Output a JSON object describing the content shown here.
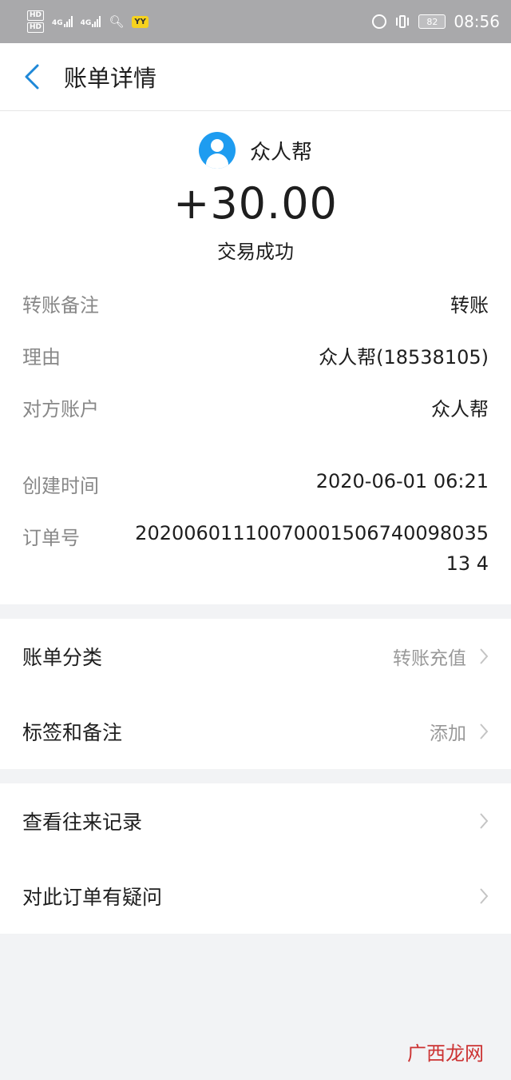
{
  "status_bar": {
    "hd1": "HD",
    "hd2": "HD",
    "net1": "4G",
    "net2": "4G",
    "yy": "YY",
    "battery": "82",
    "time": "08:56"
  },
  "nav": {
    "title": "账单详情"
  },
  "summary": {
    "payer_name": "众人帮",
    "amount": "+30.00",
    "status": "交易成功"
  },
  "details": {
    "rows": [
      {
        "label": "转账备注",
        "value": "转账"
      },
      {
        "label": "理由",
        "value": "众人帮(18538105)"
      },
      {
        "label": "对方账户",
        "value": "众人帮"
      },
      {
        "label": "创建时间",
        "value": "2020-06-01 06:21"
      },
      {
        "label": "订单号",
        "value": "2020060111007000150674009803513 4"
      }
    ]
  },
  "group1": [
    {
      "label": "账单分类",
      "value": "转账充值"
    },
    {
      "label": "标签和备注",
      "value": "添加"
    }
  ],
  "group2": [
    {
      "label": "查看往来记录"
    },
    {
      "label": "对此订单有疑问"
    }
  ],
  "watermark": "广西龙网",
  "colors": {
    "accent": "#1e9cf0",
    "status_bar": "#a9a9ab",
    "label_gray": "#888888"
  }
}
